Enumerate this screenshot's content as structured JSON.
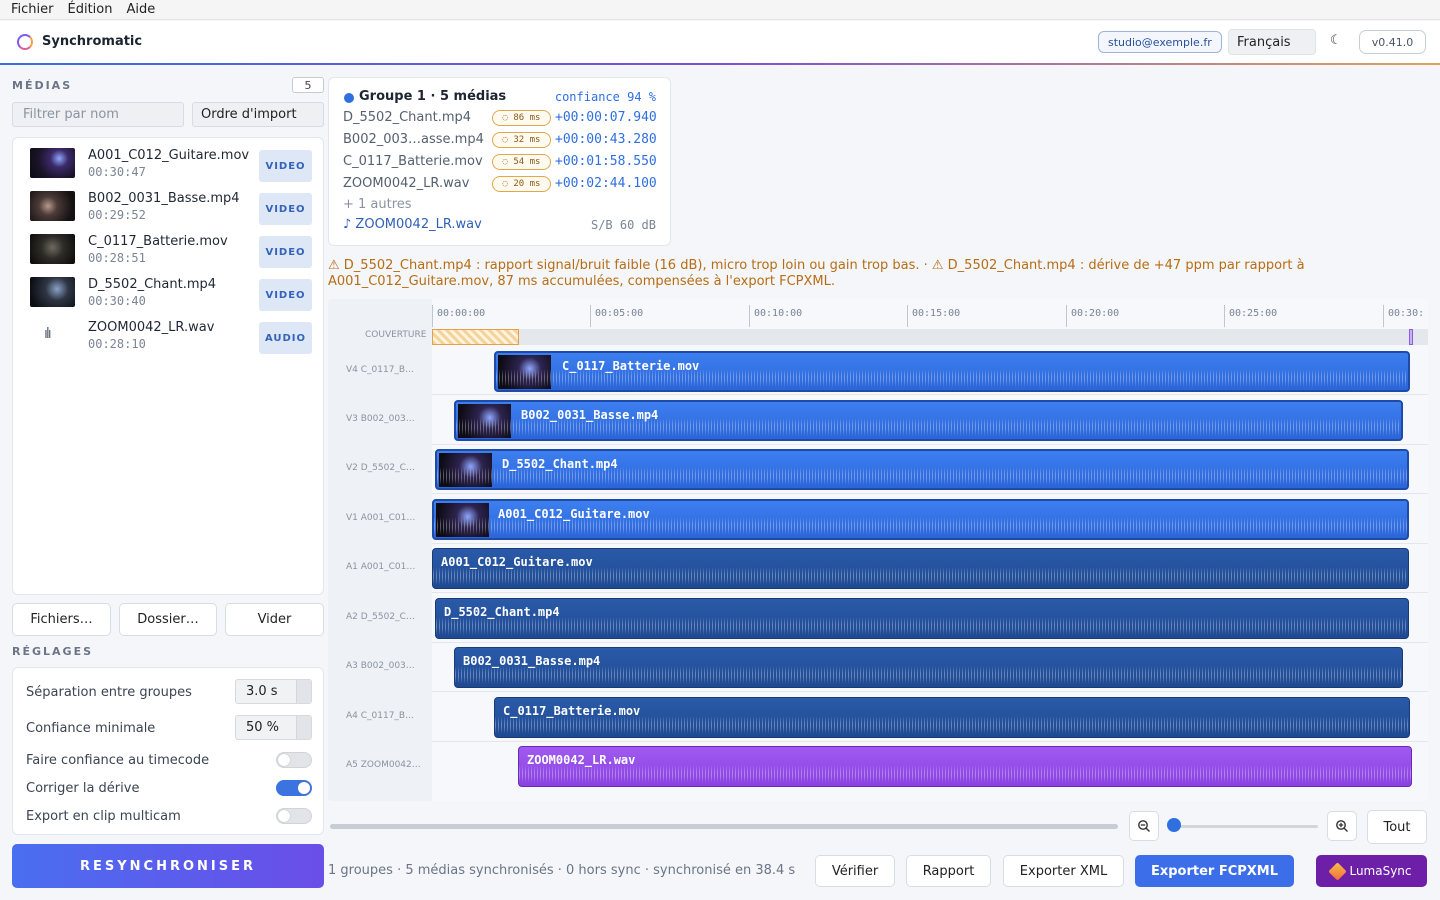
{
  "menu": {
    "items": [
      "Fichier",
      "Édition",
      "Aide"
    ]
  },
  "header": {
    "app_title": "Synchromatic",
    "email": "studio@exemple.fr",
    "language": "Français",
    "theme_icon": "☾",
    "version": "v0.41.0"
  },
  "media": {
    "section_title": "MÉDIAS",
    "count": "5",
    "filter_placeholder": "Filtrer par nom",
    "order": "Ordre d'import",
    "items": [
      {
        "name": "A001_C012_Guitare.mov",
        "duration": "00:30:47",
        "type": "VIDEO"
      },
      {
        "name": "B002_0031_Basse.mp4",
        "duration": "00:29:52",
        "type": "VIDEO"
      },
      {
        "name": "C_0117_Batterie.mov",
        "duration": "00:28:51",
        "type": "VIDEO"
      },
      {
        "name": "D_5502_Chant.mp4",
        "duration": "00:30:40",
        "type": "VIDEO"
      },
      {
        "name": "ZOOM0042_LR.wav",
        "duration": "00:28:10",
        "type": "AUDIO",
        "icon": "waveform-icon"
      }
    ],
    "buttons": {
      "files": "Fichiers…",
      "folder": "Dossier…",
      "clear": "Vider"
    }
  },
  "settings": {
    "section_title": "RÉGLAGES",
    "separation_label": "Séparation entre groupes",
    "separation_value": "3.0 s",
    "confidence_label": "Confiance minimale",
    "confidence_value": "50 %",
    "timecode_label": "Faire confiance au timecode",
    "timecode_on": false,
    "drift_label": "Corriger la dérive",
    "drift_on": true,
    "multicam_label": "Export en clip multicam",
    "multicam_on": false
  },
  "resync_label": "RESYNCHRONISER",
  "group": {
    "title": "Groupe 1 · 5 médias",
    "confidence": "confiance 94 %",
    "rows": [
      {
        "name": "D_5502_Chant.mp4",
        "pill": "◌ 86 ms",
        "offset": "+00:00:07.940"
      },
      {
        "name": "B002_003…asse.mp4",
        "pill": "◌ 32 ms",
        "offset": "+00:00:43.280"
      },
      {
        "name": "C_0117_Batterie.mov",
        "pill": "◌ 54 ms",
        "offset": "+00:01:58.550"
      },
      {
        "name": "ZOOM0042_LR.wav",
        "pill": "◌ 20 ms",
        "offset": "+00:02:44.100"
      }
    ],
    "more": "+ 1 autres",
    "reference": "♪ ZOOM0042_LR.wav",
    "snr": "S/B 60 dB"
  },
  "warning": "⚠ D_5502_Chant.mp4 : rapport signal/bruit faible (16 dB), micro trop loin ou gain trop bas.  ·  ⚠ D_5502_Chant.mp4 : dérive de +47 ppm par rapport à A001_C012_Guitare.mov, 87 ms accumulées, compensées à l'export FCPXML.",
  "timeline": {
    "ruler": [
      "00:00:00",
      "00:05:00",
      "00:10:00",
      "00:15:00",
      "00:20:00",
      "00:25:00",
      "00:30:"
    ],
    "cover_label": "COUVERTURE",
    "tracks": [
      {
        "label": "V4 C_0117_B…",
        "clip": "C_0117_Batterie.mov",
        "kind": "video"
      },
      {
        "label": "V3 B002_003…",
        "clip": "B002_0031_Basse.mp4",
        "kind": "video"
      },
      {
        "label": "V2 D_5502_C…",
        "clip": "D_5502_Chant.mp4",
        "kind": "video"
      },
      {
        "label": "V1 A001_C01…",
        "clip": "A001_C012_Guitare.mov",
        "kind": "video"
      },
      {
        "label": "A1 A001_C01…",
        "clip": "A001_C012_Guitare.mov",
        "kind": "audio"
      },
      {
        "label": "A2 D_5502_C…",
        "clip": "D_5502_Chant.mp4",
        "kind": "audio"
      },
      {
        "label": "A3 B002_003…",
        "clip": "B002_0031_Basse.mp4",
        "kind": "audio"
      },
      {
        "label": "A4 C_0117_B…",
        "clip": "C_0117_Batterie.mov",
        "kind": "audio"
      },
      {
        "label": "A5 ZOOM0042…",
        "clip": "ZOOM0042_LR.wav",
        "kind": "master"
      }
    ]
  },
  "zoom": {
    "out_icon": "zoom-out-icon",
    "in_icon": "zoom-in-icon",
    "fit": "Tout"
  },
  "footer": {
    "status": "1 groupes · 5 médias synchronisés · 0 hors sync  ·  synchronisé en 38.4 s",
    "verify": "Vérifier",
    "report": "Rapport",
    "export_xml": "Exporter XML",
    "export_fcp": "Exporter FCPXML",
    "luma": "LumaSync"
  },
  "colors": {
    "accent": "#3b6ee8",
    "video_clip": "#3d7ff0",
    "audio_clip": "#2a5aa8",
    "master_clip": "#a05af0",
    "warning": "#b86d14"
  }
}
